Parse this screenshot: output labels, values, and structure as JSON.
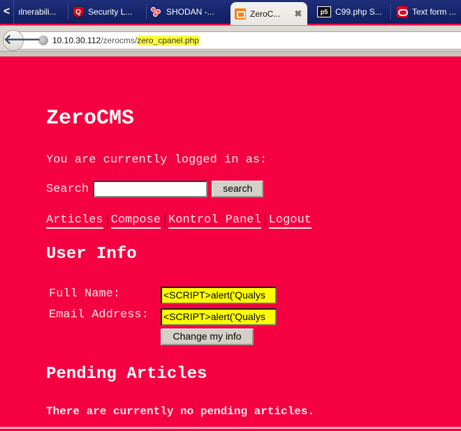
{
  "browser": {
    "tabs": [
      {
        "label": "ılnerabili...",
        "icon": "page-icon",
        "active": false
      },
      {
        "label": "Security L...",
        "icon": "qualys-icon",
        "active": false
      },
      {
        "label": "SHODAN -...",
        "icon": "shodan-icon",
        "active": false
      },
      {
        "label": "ZeroC...",
        "icon": "xampp-icon",
        "active": true
      },
      {
        "label": "C99.php S...",
        "icon": "c99-icon",
        "active": false
      },
      {
        "label": "Text form ...",
        "icon": "oracle-icon",
        "active": false
      }
    ],
    "tab_scroll_glyph": "<",
    "close_glyph": "✖",
    "back_glyph": "🡐",
    "url": {
      "host": "10.10.30.112",
      "path": "/zerocms/",
      "highlighted": "zero_cpanel.php"
    }
  },
  "page": {
    "site_title": "ZeroCMS",
    "logged_in_text": "You are currently logged in as:",
    "search": {
      "label": "Search",
      "value": "",
      "button_label": "search"
    },
    "nav_links": [
      "Articles",
      "Compose",
      "Kontrol Panel",
      "Logout"
    ],
    "user_info": {
      "title": "User Info",
      "full_name_label": "Full Name:",
      "full_name_value": "<SCRIPT>alert('Qualys",
      "email_label": "Email Address:",
      "email_value": "<SCRIPT>alert('Qualys",
      "submit_label": "Change my info"
    },
    "pending": {
      "title": "Pending Articles",
      "message": "There are currently no pending articles."
    }
  },
  "colors": {
    "page_background": "#f50040",
    "highlight": "#ffff00",
    "tab_strip": "#15246a"
  }
}
